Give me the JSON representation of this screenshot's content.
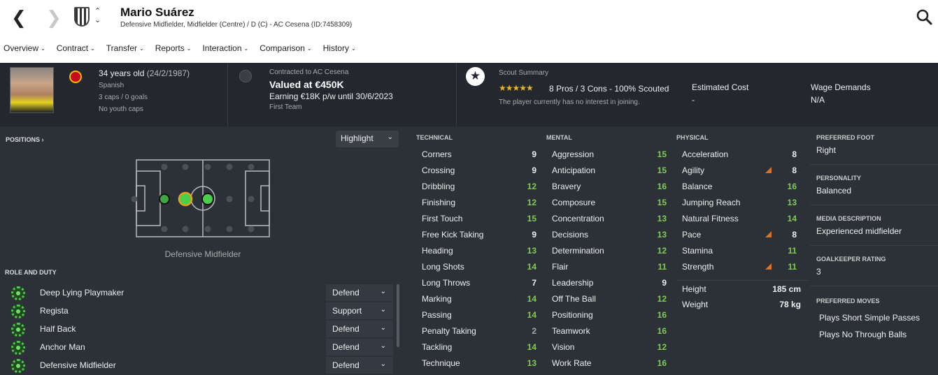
{
  "header": {
    "name": "Mario Suárez",
    "subtitle": "Defensive Midfielder, Midfielder (Centre) / D (C) - AC Cesena (ID:7458309)",
    "tabs": [
      "Overview",
      "Contract",
      "Transfer",
      "Reports",
      "Interaction",
      "Comparison",
      "History"
    ]
  },
  "info": {
    "age": "34 years old",
    "dob": "(24/2/1987)",
    "nationality": "Spanish",
    "caps": "3 caps / 0 goals",
    "youth": "No youth caps",
    "contract_label": "Contracted to AC Cesena",
    "valued": "Valued at €450K",
    "earning": "Earning €18K p/w until 30/6/2023",
    "squad": "First Team",
    "scout_title": "Scout Summary",
    "scout_stars": "★★★★★",
    "scout_rating": 4.5,
    "scout_summary": "8 Pros / 3 Cons - 100% Scouted",
    "interest": "The player currently has no interest in joining.",
    "est_cost_label": "Estimated Cost",
    "est_cost_value": "-",
    "wage_label": "Wage Demands",
    "wage_value": "N/A"
  },
  "positions": {
    "title": "POSITIONS ›",
    "highlight": "Highlight",
    "position_name": "Defensive Midfielder"
  },
  "roles": {
    "title": "ROLE AND DUTY",
    "items": [
      {
        "name": "Deep Lying Playmaker",
        "duty": "Defend"
      },
      {
        "name": "Regista",
        "duty": "Support"
      },
      {
        "name": "Half Back",
        "duty": "Defend"
      },
      {
        "name": "Anchor Man",
        "duty": "Defend"
      },
      {
        "name": "Defensive Midfielder",
        "duty": "Defend"
      }
    ]
  },
  "technical": {
    "title": "TECHNICAL",
    "items": [
      {
        "label": "Corners",
        "value": "9"
      },
      {
        "label": "Crossing",
        "value": "9"
      },
      {
        "label": "Dribbling",
        "value": "12"
      },
      {
        "label": "Finishing",
        "value": "12"
      },
      {
        "label": "First Touch",
        "value": "15"
      },
      {
        "label": "Free Kick Taking",
        "value": "9"
      },
      {
        "label": "Heading",
        "value": "13"
      },
      {
        "label": "Long Shots",
        "value": "14"
      },
      {
        "label": "Long Throws",
        "value": "7"
      },
      {
        "label": "Marking",
        "value": "14"
      },
      {
        "label": "Passing",
        "value": "14"
      },
      {
        "label": "Penalty Taking",
        "value": "2"
      },
      {
        "label": "Tackling",
        "value": "14"
      },
      {
        "label": "Technique",
        "value": "13"
      }
    ]
  },
  "mental": {
    "title": "MENTAL",
    "items": [
      {
        "label": "Aggression",
        "value": "15"
      },
      {
        "label": "Anticipation",
        "value": "15"
      },
      {
        "label": "Bravery",
        "value": "16"
      },
      {
        "label": "Composure",
        "value": "15"
      },
      {
        "label": "Concentration",
        "value": "13"
      },
      {
        "label": "Decisions",
        "value": "13"
      },
      {
        "label": "Determination",
        "value": "12"
      },
      {
        "label": "Flair",
        "value": "11"
      },
      {
        "label": "Leadership",
        "value": "9"
      },
      {
        "label": "Off The Ball",
        "value": "12"
      },
      {
        "label": "Positioning",
        "value": "16"
      },
      {
        "label": "Teamwork",
        "value": "16"
      },
      {
        "label": "Vision",
        "value": "12"
      },
      {
        "label": "Work Rate",
        "value": "16"
      }
    ]
  },
  "physical": {
    "title": "PHYSICAL",
    "items": [
      {
        "label": "Acceleration",
        "value": "8",
        "declining": false
      },
      {
        "label": "Agility",
        "value": "8",
        "declining": true
      },
      {
        "label": "Balance",
        "value": "16",
        "declining": false
      },
      {
        "label": "Jumping Reach",
        "value": "13",
        "declining": false
      },
      {
        "label": "Natural Fitness",
        "value": "14",
        "declining": false
      },
      {
        "label": "Pace",
        "value": "8",
        "declining": true
      },
      {
        "label": "Stamina",
        "value": "11",
        "declining": false
      },
      {
        "label": "Strength",
        "value": "11",
        "declining": true
      }
    ],
    "height_label": "Height",
    "height_value": "185 cm",
    "weight_label": "Weight",
    "weight_value": "78 kg"
  },
  "details": {
    "foot_label": "PREFERRED FOOT",
    "foot_value": "Right",
    "personality_label": "PERSONALITY",
    "personality_value": "Balanced",
    "media_label": "MEDIA DESCRIPTION",
    "media_value": "Experienced midfielder",
    "gk_label": "GOALKEEPER RATING",
    "gk_value": "3",
    "moves_label": "PREFERRED MOVES",
    "moves": [
      "Plays Short Simple Passes",
      "Plays No Through Balls"
    ]
  },
  "colors": {
    "attr_low": "#a8a8a8",
    "attr_mid": "#eeeeee",
    "attr_high": "#7fcf4c",
    "decline_arrow": "#d5742a",
    "scout_star": "#e8b524"
  }
}
